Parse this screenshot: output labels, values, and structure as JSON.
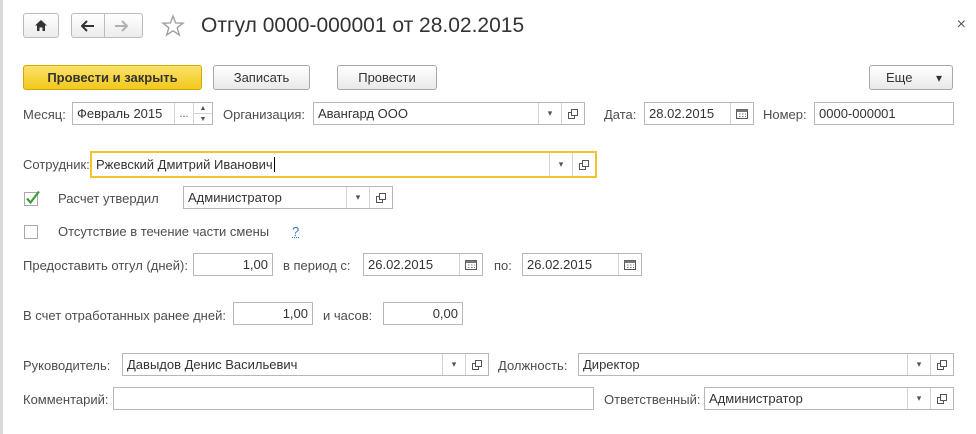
{
  "title": "Отгул 0000-000001 от 28.02.2015",
  "close_symbol": "×",
  "toolbar": {
    "post_close": "Провести и закрыть",
    "save": "Записать",
    "post": "Провести",
    "more": "Еще"
  },
  "fields": {
    "month_label": "Месяц:",
    "month_value": "Февраль 2015",
    "month_ellipsis": "...",
    "org_label": "Организация:",
    "org_value": "Авангард ООО",
    "date_label": "Дата:",
    "date_value": "28.02.2015",
    "number_label": "Номер:",
    "number_value": "0000-000001",
    "employee_label": "Сотрудник:",
    "employee_value": "Ржевский Дмитрий Иванович",
    "approved_label": "Расчет утвердил",
    "approved_checked": true,
    "approved_value": "Администратор",
    "partial_label": "Отсутствие в течение части смены",
    "partial_checked": false,
    "help": "?",
    "days_label": "Предоставить отгул (дней):",
    "days_value": "1,00",
    "period_label": "в период с:",
    "period_from": "26.02.2015",
    "period_to_label": "по:",
    "period_to": "26.02.2015",
    "worked_days_label": "В счет отработанных ранее дней:",
    "worked_days_value": "1,00",
    "hours_label": "и часов:",
    "hours_value": "0,00",
    "manager_label": "Руководитель:",
    "manager_value": "Давыдов Денис Васильевич",
    "position_label": "Должность:",
    "position_value": "Директор",
    "comment_label": "Комментарий:",
    "comment_value": "",
    "responsible_label": "Ответственный:",
    "responsible_value": "Администратор"
  },
  "icons": {
    "dropdown": "▾",
    "spin_up": "▲",
    "spin_down": "▼"
  }
}
